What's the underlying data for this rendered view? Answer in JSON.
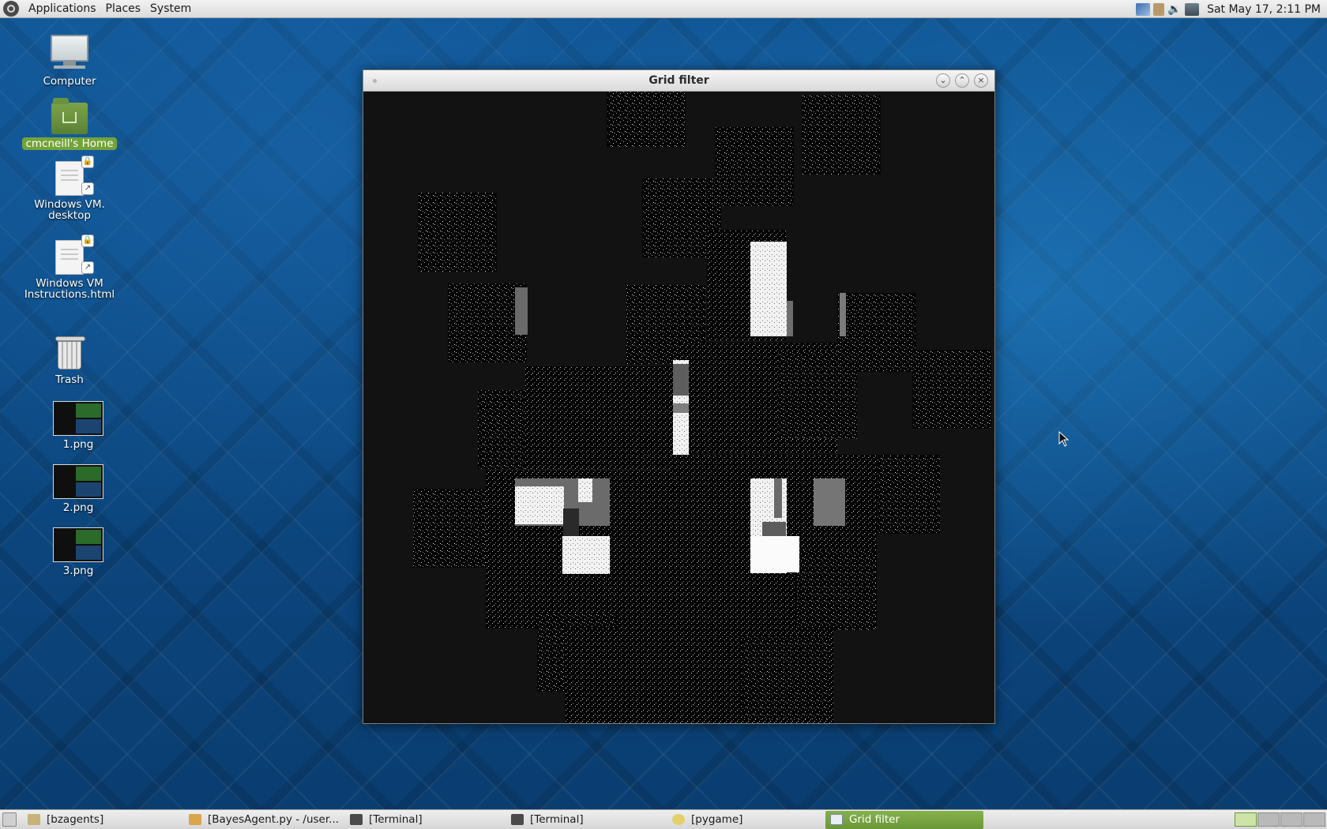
{
  "top_panel": {
    "menus": [
      "Applications",
      "Places",
      "System"
    ],
    "clock": "Sat May 17,  2:11 PM",
    "tray_icons": [
      "network-manager-icon",
      "clipboard-icon",
      "volume-icon",
      "network-wired-icon"
    ]
  },
  "desktop_icons": [
    {
      "name": "computer",
      "label": "Computer",
      "icon": "computer-icon"
    },
    {
      "name": "home",
      "label": "cmcneill's Home",
      "icon": "home-folder-icon",
      "selected": true
    },
    {
      "name": "windows-vm-desktop",
      "label_lines": [
        "Windows VM.",
        "desktop"
      ],
      "icon": "document-icon"
    },
    {
      "name": "windows-vm-instructions",
      "label_lines": [
        "Windows VM",
        "Instructions.html"
      ],
      "icon": "document-icon"
    },
    {
      "name": "trash",
      "label": "Trash",
      "icon": "trash-icon"
    },
    {
      "name": "1png",
      "label": "1.png",
      "icon": "image-thumbnail-icon"
    },
    {
      "name": "2png",
      "label": "2.png",
      "icon": "image-thumbnail-icon"
    },
    {
      "name": "3png",
      "label": "3.png",
      "icon": "image-thumbnail-icon"
    }
  ],
  "window": {
    "title": "Grid filter",
    "buttons": [
      "minimize",
      "maximize",
      "close"
    ],
    "button_glyphs": {
      "minimize": "⌄",
      "maximize": "⌃",
      "close": "×"
    },
    "canvas_background": "#121212"
  },
  "taskbar": {
    "tasks": [
      {
        "label": "[bzagents]",
        "icon": "folder-icon",
        "active": false
      },
      {
        "label": "[BayesAgent.py - /user...",
        "icon": "text-editor-icon",
        "active": false
      },
      {
        "label": "[Terminal]",
        "icon": "terminal-icon",
        "active": false
      },
      {
        "label": "[Terminal]",
        "icon": "terminal-icon",
        "active": false
      },
      {
        "label": "[pygame]",
        "icon": "python-icon",
        "active": false
      },
      {
        "label": "Grid filter",
        "icon": "window-icon",
        "active": true
      }
    ],
    "workspaces": 4,
    "active_workspace": 1
  },
  "colors": {
    "panel": "#e4e4e4",
    "active_green": "#73a33a",
    "desktop_blue": "#0d4a86"
  }
}
